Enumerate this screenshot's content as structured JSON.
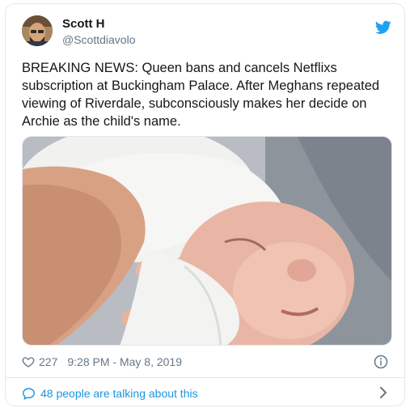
{
  "tweet": {
    "display_name": "Scott H",
    "handle": "@Scottdiavolo",
    "text": "BREAKING NEWS: Queen bans and cancels Netflixs subscription at Buckingham Palace. After Meghans repeated viewing of Riverdale, subconsciously makes her decide on Archie as the child's name.",
    "likes": "227",
    "timestamp": "9:28 PM - May 8, 2019"
  },
  "footer": {
    "talking_label": "48 people are talking about this"
  },
  "icons": {
    "brand": "twitter-bird-icon",
    "like": "heart-icon",
    "info": "info-icon",
    "talking": "speech-bubble-icon",
    "more": "chevron-right-icon"
  },
  "colors": {
    "twitter_blue": "#1da1f2",
    "link_blue": "#1b95e0",
    "secondary_text": "#657786",
    "border": "#e1e8ed"
  }
}
